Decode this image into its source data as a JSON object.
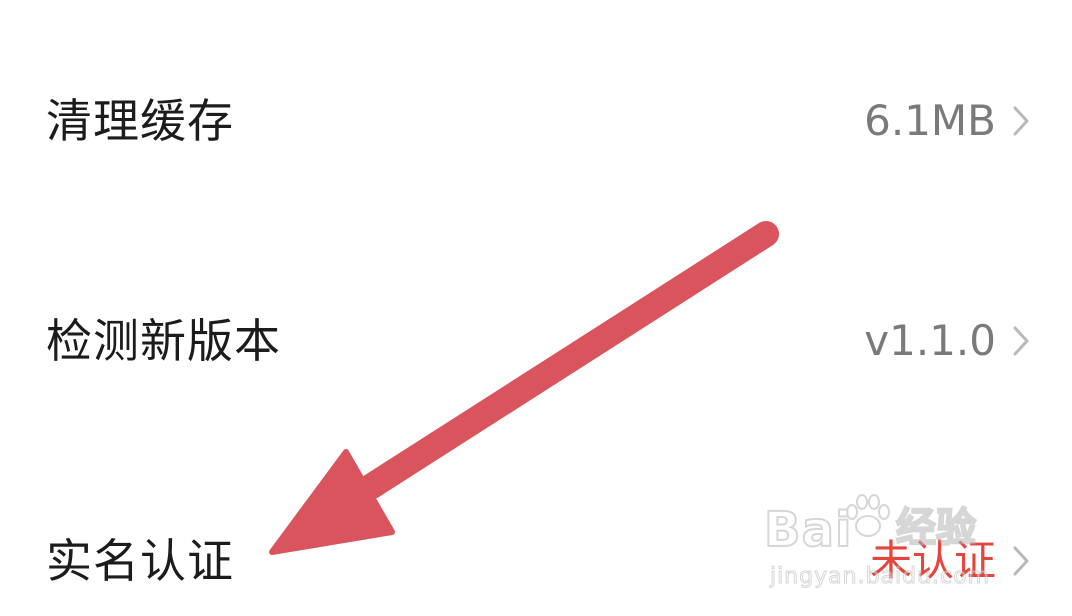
{
  "settings": {
    "rows": [
      {
        "label": "清理缓存",
        "value": "6.1MB"
      },
      {
        "label": "检测新版本",
        "value": "v1.1.0"
      },
      {
        "label": "实名认证",
        "value": "未认证"
      }
    ]
  },
  "annotation": {
    "arrow_color": "#d9545c"
  },
  "watermark": {
    "brand": "Bai",
    "brand_cn": "经验",
    "site": "jingyan.baidu.com"
  },
  "colors": {
    "label": "#1c1c1c",
    "value": "#7a7a7a",
    "warning": "#e2463d",
    "chevron": "#b8b8b8"
  },
  "icons": {
    "row_chevron": "chevron-right-icon",
    "annotation": "red-arrow-annotation",
    "watermark_paw": "paw-icon"
  }
}
